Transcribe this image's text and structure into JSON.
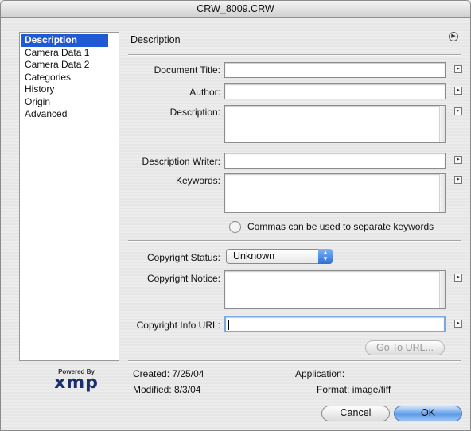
{
  "window": {
    "title": "CRW_8009.CRW"
  },
  "sidebar": {
    "items": [
      {
        "label": "Description"
      },
      {
        "label": "Camera Data 1"
      },
      {
        "label": "Camera Data 2"
      },
      {
        "label": "Categories"
      },
      {
        "label": "History"
      },
      {
        "label": "Origin"
      },
      {
        "label": "Advanced"
      }
    ],
    "selected_index": 0
  },
  "logo": {
    "powered_by": "Powered By",
    "brand": "xmp"
  },
  "section": {
    "title": "Description"
  },
  "fields": {
    "document_title": {
      "label": "Document Title:",
      "value": ""
    },
    "author": {
      "label": "Author:",
      "value": ""
    },
    "description": {
      "label": "Description:",
      "value": ""
    },
    "description_writer": {
      "label": "Description Writer:",
      "value": ""
    },
    "keywords": {
      "label": "Keywords:",
      "value": ""
    },
    "keywords_note": "Commas can be used to separate keywords",
    "copyright_status": {
      "label": "Copyright Status:",
      "value": "Unknown"
    },
    "copyright_notice": {
      "label": "Copyright Notice:",
      "value": ""
    },
    "copyright_info_url": {
      "label": "Copyright Info URL:",
      "value": ""
    }
  },
  "buttons": {
    "go_to_url": "Go To URL...",
    "cancel": "Cancel",
    "ok": "OK"
  },
  "info": {
    "created_label": "Created:",
    "created": "7/25/04",
    "modified_label": "Modified:",
    "modified": "8/3/04",
    "application_label": "Application:",
    "application": "",
    "format_label": "Format:",
    "format": "image/tiff"
  },
  "colors": {
    "selection": "#1f59d4",
    "focus_ring": "#7ca8e0",
    "default_button": "#5c9ae6"
  }
}
